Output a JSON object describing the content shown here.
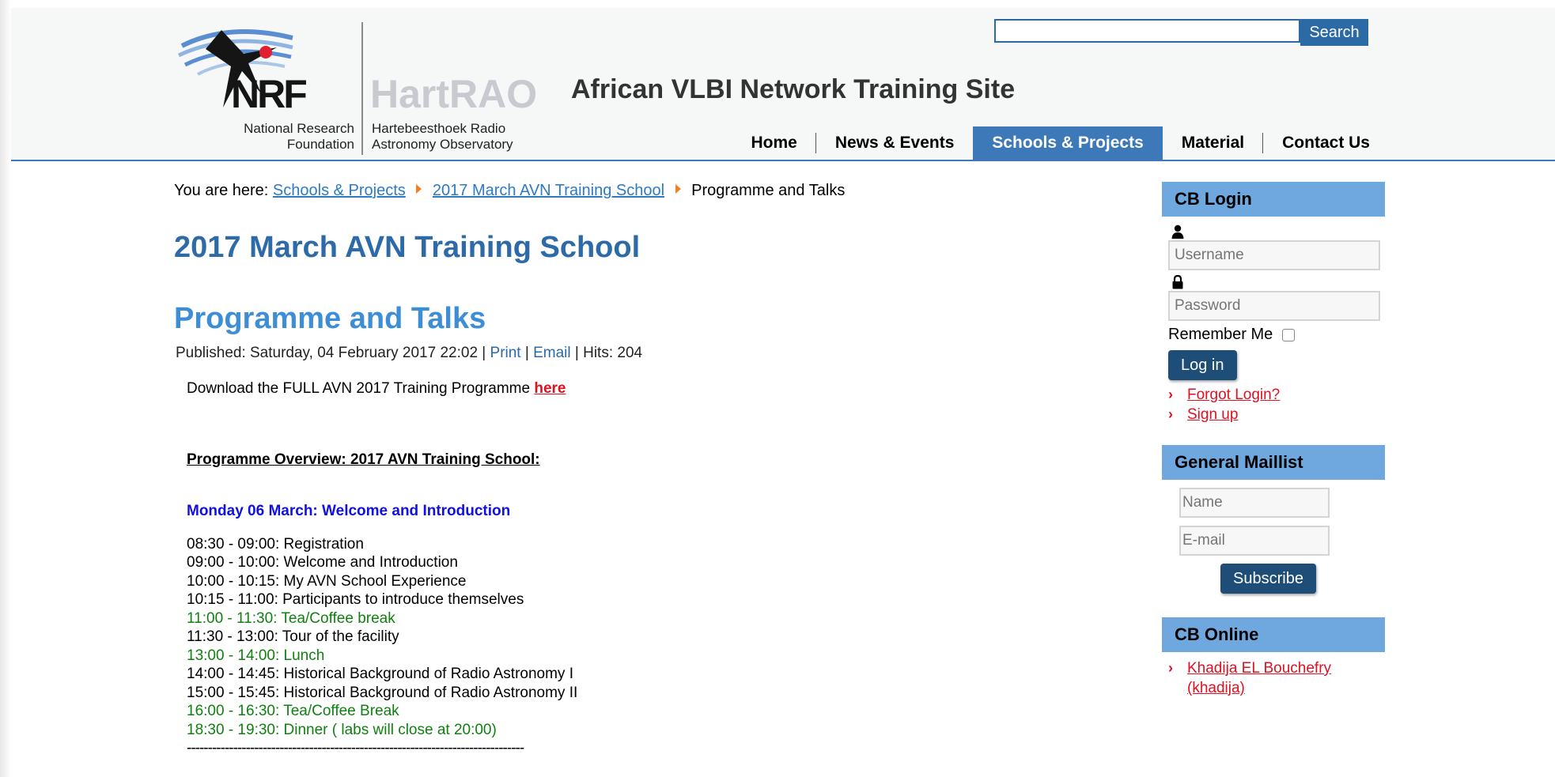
{
  "site": {
    "title": "African VLBI Network Training Site",
    "logo": {
      "nrf_text": "NRF",
      "nrf_line1": "National Research",
      "nrf_line2": "Foundation",
      "hartrao_text": "HartRAO",
      "hartrao_line1": "Hartebeesthoek Radio",
      "hartrao_line2": "Astronomy Observatory"
    }
  },
  "search": {
    "value": "",
    "button_label": "Search"
  },
  "nav": {
    "items": [
      {
        "label": "Home"
      },
      {
        "label": "News & Events"
      },
      {
        "label": "Schools & Projects"
      },
      {
        "label": "Material"
      },
      {
        "label": "Contact Us"
      }
    ],
    "active": "Schools & Projects"
  },
  "breadcrumb": {
    "prefix": "You are here:",
    "items": [
      "Schools & Projects",
      "2017 March AVN Training School",
      "Programme and Talks"
    ]
  },
  "article": {
    "category": "2017 March AVN Training School",
    "title": "Programme and Talks",
    "published": "Published: Saturday, 04 February 2017 22:02",
    "sep": "|",
    "print_label": "Print",
    "email_label": "Email",
    "hits": "Hits: 204",
    "download_text": "Download the FULL AVN 2017 Training Programme",
    "download_link": "here",
    "overview_heading": "Programme Overview: 2017 AVN Training School:",
    "day_heading": "Monday 06 March: Welcome and Introduction",
    "schedule": [
      "08:30 - 09:00: Registration",
      "09:00 - 10:00: Welcome and Introduction",
      "10:00 - 10:15: My AVN School Experience",
      "10:15 - 11:00: Participants to introduce themselves",
      "11:00 - 11:30: Tea/Coffee break",
      "11:30 - 13:00: Tour of the facility",
      "13:00 - 14:00: Lunch",
      "14:00 - 14:45: Historical Background of Radio Astronomy I",
      "15:00 - 15:45: Historical Background of Radio Astronomy II",
      "16:00 - 16:30: Tea/Coffee Break",
      "18:30 - 19:30: Dinner ( labs will close at 20:00)"
    ],
    "divider": "--------------------------------------------------------------------------------"
  },
  "login": {
    "title": "CB Login",
    "username_placeholder": "Username",
    "password_placeholder": "Password",
    "remember_label": "Remember Me",
    "login_button": "Log in",
    "forgot_link": "Forgot Login?",
    "signup_link": "Sign up"
  },
  "maillist": {
    "title": "General Maillist",
    "name_placeholder": "Name",
    "email_placeholder": "E-mail",
    "subscribe_button": "Subscribe"
  },
  "online": {
    "title": "CB Online",
    "user_line1": "Khadija EL Bouchefry",
    "user_line2": "(khadija)"
  },
  "colors": {
    "header_bg": "#f6f8f8",
    "nav_active": "#3d79b8",
    "link_blue": "#2c7bc4",
    "module_blue": "#6fa8de",
    "break_green": "#108010",
    "day_blue": "#1010e0",
    "red_link": "#e01020"
  }
}
